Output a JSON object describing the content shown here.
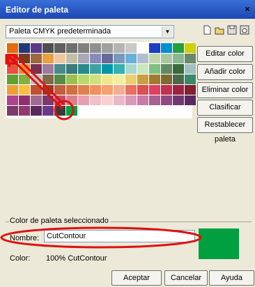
{
  "window": {
    "title": "Editor de paleta",
    "close_glyph": "×"
  },
  "palette_select": {
    "value": "Paleta CMYK predeterminada",
    "arrow": "▼"
  },
  "toolbar": [
    "new-palette-icon",
    "open-palette-icon",
    "save-palette-icon",
    "save-as-palette-icon"
  ],
  "swatches": [
    "#e46c0a",
    "#1f3a7a",
    "#5a3a8c",
    "#4f4f4f",
    "#5f5f5f",
    "#6f6f6f",
    "#808080",
    "#909090",
    "#a0a0a0",
    "#b4b4b4",
    "#c8c8c8",
    "#ffffff",
    "#1a3cc8",
    "#0090d0",
    "#20a040",
    "#d0d000",
    "#e83a20",
    "#7a3a20",
    "#9a6a40",
    "#e8a040",
    "#f0c8a0",
    "#c0c0a8",
    "#a8a8b8",
    "#8a8ab8",
    "#6a6a98",
    "#7a98b8",
    "#6ab0d8",
    "#b0c0d0",
    "#c0d8a8",
    "#a8c8a0",
    "#88b890",
    "#6a8a6a",
    "#e85040",
    "#f08c2c",
    "#7a3050",
    "#a07a9a",
    "#4a8a8a",
    "#3a7a7a",
    "#2a8a8a",
    "#40a0a0",
    "#0098a8",
    "#38b0b0",
    "#a8d8d0",
    "#c8e8c0",
    "#80c080",
    "#608a60",
    "#3a6a3a",
    "#a0c0c0",
    "#60a030",
    "#80b040",
    "#c0c0c0",
    "#806a4a",
    "#5a8a4a",
    "#9ac050",
    "#b8d870",
    "#d0e080",
    "#f0e890",
    "#f0f0a0",
    "#e8d070",
    "#c8a040",
    "#a07a30",
    "#806a30",
    "#4a6a4a",
    "#3a8a6a",
    "#f0a030",
    "#f8c040",
    "#c05030",
    "#904028",
    "#c06040",
    "#d07040",
    "#e08050",
    "#f09060",
    "#f8a070",
    "#f0b090",
    "#e87060",
    "#d85050",
    "#e04060",
    "#c03050",
    "#a02040",
    "#802030",
    "#b04090",
    "#903070",
    "#a06a90",
    "#7a3a6a",
    "#c05070",
    "#d88090",
    "#e8a0b0",
    "#f0c0c8",
    "#f8d0d0",
    "#e8b8c8",
    "#d898b8",
    "#c87aa8",
    "#a86090",
    "#904880",
    "#703870",
    "#582860",
    "#7a3a6a",
    "#903a70",
    "#5a2a5a",
    "#6a3a8a",
    "#3a3a3a",
    "#00a040"
  ],
  "actions": {
    "edit": "Editar color",
    "add": "Añadir color",
    "delete": "Eliminar color",
    "sort": "Clasificar colores",
    "sort_arrow": "▼",
    "reset": "Restablecer paleta"
  },
  "selected": {
    "group_label": "Color de paleta seleccionado",
    "name_label": "Nombre:",
    "name_value": "CutContour",
    "color_label": "Color:",
    "color_value": "100%  CutContour",
    "swatch_color": "#00a040"
  },
  "buttons": {
    "ok": "Aceptar",
    "cancel": "Cancelar",
    "help": "Ayuda"
  },
  "annotation_color": "#e01010"
}
